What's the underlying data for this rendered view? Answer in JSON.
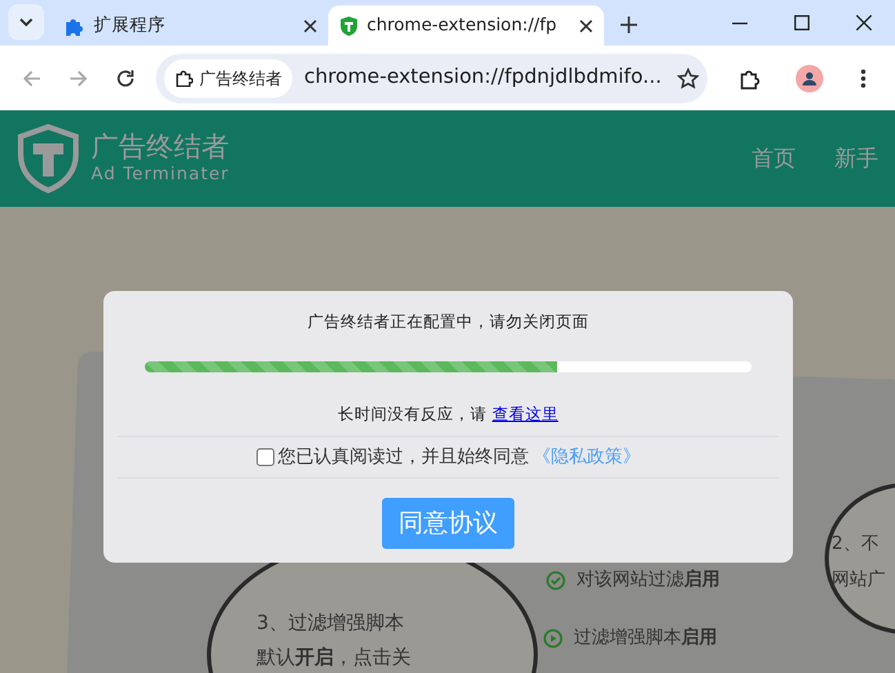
{
  "browser": {
    "tabs": [
      {
        "title": "扩展程序",
        "selected": false
      },
      {
        "title": "chrome-extension://fp",
        "selected": true
      }
    ],
    "address_bar": {
      "site_chip": "广告终结者",
      "url": "chrome-extension://fpdnjdlbdmifo..."
    }
  },
  "site_header": {
    "logo_title": "广告终结者",
    "logo_subtitle": "Ad Terminater",
    "nav": [
      {
        "label": "首页"
      },
      {
        "label": "新手"
      }
    ]
  },
  "background_illustration": {
    "rows": [
      {
        "text": "对该网站过滤**启用**"
      },
      {
        "text": "过滤增强脚本**启用**"
      }
    ],
    "left_bubble": [
      "3、过滤增强脚本",
      "默认**开启**，点击关"
    ],
    "right_bubble": [
      "2、不",
      "网站广"
    ]
  },
  "dialog": {
    "status": "广告终结者正在配置中，请勿关闭页面",
    "progress": {
      "level": 0.68
    },
    "help_text": "长时间没有反应，请",
    "help_link": "查看这里",
    "consent": {
      "checked": false,
      "text": "您已认真阅读过，并且始终同意",
      "link": "《隐私政策》"
    },
    "button": "同意协议"
  }
}
